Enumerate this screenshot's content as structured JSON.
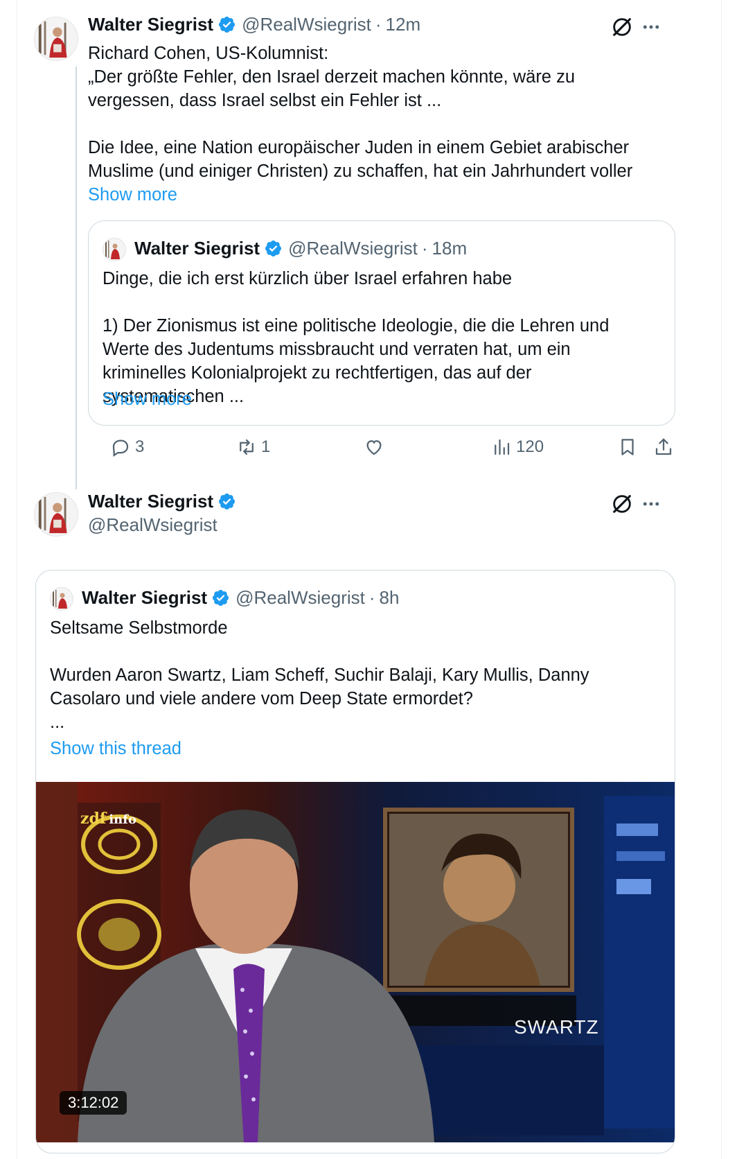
{
  "tweet1": {
    "author_name": "Walter Siegrist",
    "handle": "@RealWsiegrist",
    "separator": "·",
    "time": "12m",
    "text": "Richard Cohen, US-Kolumnist:\n„Der größte Fehler, den Israel derzeit machen könnte, wäre zu vergessen, dass Israel selbst ein Fehler ist ...\n\nDie Idee, eine Nation europäischer Juden in einem Gebiet arabischer Muslime (und einiger Christen) zu schaffen, hat ein Jahrhundert voller",
    "show_more": "Show more",
    "quote": {
      "author_name": "Walter Siegrist",
      "handle": "@RealWsiegrist",
      "separator": "·",
      "time": "18m",
      "text": "Dinge, die ich erst kürzlich über Israel erfahren habe\n\n1) Der Zionismus ist eine politische Ideologie, die die Lehren und Werte des Judentums missbraucht und verraten hat, um ein kriminelles Kolonialprojekt zu rechtfertigen, das auf der systematischen ...",
      "show_more": "Show more"
    },
    "actions": {
      "replies": "3",
      "reposts": "1",
      "likes": "",
      "views": "120"
    }
  },
  "tweet2": {
    "author_name": "Walter Siegrist",
    "handle": "@RealWsiegrist",
    "quote": {
      "author_name": "Walter Siegrist",
      "handle": "@RealWsiegrist",
      "separator": "·",
      "time": "8h",
      "text": "Seltsame Selbstmorde\n\nWurden Aaron Swartz, Liam Scheff, Suchir Balaji, Kary Mullis, Danny Casolaro und viele andere vom Deep State ermordet?\n...",
      "show_thread": "Show this thread",
      "video": {
        "duration": "3:12:02",
        "channel_logo": "zdf",
        "channel_logo_suffix": "info",
        "caption": "SWARTZ"
      }
    }
  },
  "colors": {
    "accent": "#1d9bf0",
    "text_primary": "#0f1419",
    "text_secondary": "#536471",
    "border": "#cfd9de"
  },
  "icons": {
    "verified": "verified-badge-icon",
    "grok": "grok-icon",
    "more": "more-icon",
    "reply": "reply-icon",
    "repost": "repost-icon",
    "like": "like-icon",
    "views": "views-icon",
    "bookmark": "bookmark-icon",
    "share": "share-icon"
  }
}
